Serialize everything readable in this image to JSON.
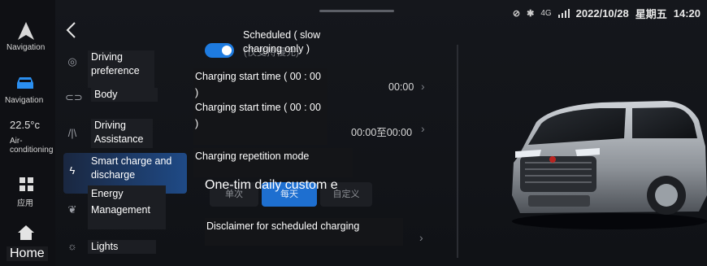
{
  "status_bar": {
    "network": "4G",
    "datetime": "2022/10/28",
    "weekday": "星期五",
    "time": "14:20"
  },
  "rail": {
    "navigation_label": "Navigation",
    "vehicle_label": "Navigation",
    "temperature": "22.5°c",
    "air_label": "Air-conditioning",
    "apps_label": "应用",
    "home_label": "Home"
  },
  "menu": {
    "items": [
      {
        "label": "Driving preference",
        "icon": "steering-wheel-icon"
      },
      {
        "label": "Body",
        "icon": "car-body-icon"
      },
      {
        "label": "Driving Assistance",
        "icon": "lane-assist-icon"
      },
      {
        "label": "Smart charge and discharge",
        "icon": "lightning-icon"
      },
      {
        "label": "Energy Management",
        "icon": "leaf-icon"
      },
      {
        "label": "Lights",
        "icon": "light-bulb-icon"
      }
    ]
  },
  "content": {
    "scheduled_label": "Scheduled ( slow charging only )",
    "scheduled_ghost": "(仅支持慢充)",
    "start_time_1_label": "Charging start time ( 00 : 00 )",
    "start_time_1_value": "00:00",
    "start_time_2_label": "Charging start time ( 00 : 00 )",
    "start_time_2_value": "00:00至00:00",
    "repetition_label": "Charging repetition mode",
    "repetition_options": "One-tim daily       custom e",
    "seg_once": "单次",
    "seg_daily": "每天",
    "seg_custom": "自定义",
    "disclaimer_label": "Disclaimer for scheduled charging"
  },
  "colors": {
    "accent": "#1e7be0",
    "background": "#121418"
  }
}
